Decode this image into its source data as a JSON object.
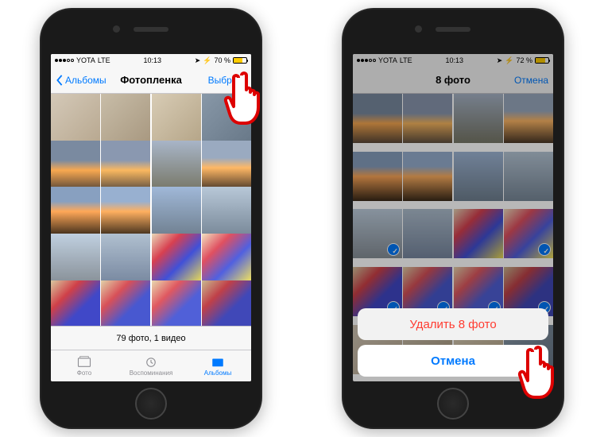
{
  "left": {
    "status": {
      "carrier": "YOTA",
      "network": "LTE",
      "time": "10:13",
      "battery": "70 %"
    },
    "nav": {
      "back": "Альбомы",
      "title": "Фотопленка",
      "action": "Выбрать"
    },
    "footer": "79 фото, 1 видео",
    "tabs": [
      {
        "label": "Фото",
        "active": false
      },
      {
        "label": "Воспоминания",
        "active": false
      },
      {
        "label": "Альбомы",
        "active": true
      }
    ]
  },
  "right": {
    "status": {
      "carrier": "YOTA",
      "network": "LTE",
      "time": "10:13",
      "battery": "72 %"
    },
    "nav": {
      "title": "8 фото",
      "action": "Отмена"
    },
    "sheet": {
      "delete": "Удалить 8 фото",
      "cancel": "Отмена"
    },
    "selected_indices": [
      8,
      11,
      12,
      13,
      14,
      15,
      16,
      17
    ]
  },
  "thumb_colors": [
    "linear-gradient(135deg,#d4c9b8,#b8a890)",
    "linear-gradient(135deg,#c8bda8,#a89880)",
    "linear-gradient(135deg,#d8ccb5,#b5a588)",
    "linear-gradient(135deg,#8898a8,#687888)",
    "linear-gradient(180deg,#7a8aa0 40%,#f8a850 60%,#5a4838)",
    "linear-gradient(180deg,#8a98b0 40%,#fab860 60%,#605040)",
    "linear-gradient(180deg,#a8b5c8,#787868)",
    "linear-gradient(180deg,#9aaac0 35%,#ffb865 55%,#4a3828)",
    "linear-gradient(180deg,#88a0c0 30%,#ffa858 50%,#382818)",
    "linear-gradient(180deg,#98b0d0 30%,#ffb060 50%,#3a2a1a)",
    "linear-gradient(180deg,#a0b8d8,#708090)",
    "linear-gradient(180deg,#b8c8d8,#788898)",
    "linear-gradient(180deg,#c0d0e0,#889098)",
    "linear-gradient(180deg,#b0c0d0,#7888a0)",
    "linear-gradient(135deg,#e8d8b8,#d84050 30%,#4050d8 60%,#f0e050)",
    "linear-gradient(135deg,#f0e0c0,#e05060 30%,#5060e0 60%,#f8e858)",
    "linear-gradient(135deg,#d8c8a0,#d04048 30%,#4048c8 60%)",
    "linear-gradient(135deg,#e0d0a8,#d85058 30%,#4858d0 60%)",
    "linear-gradient(135deg,#e8d8b0,#e05860 30%,#5060d8 60%)",
    "linear-gradient(135deg,#c8b890,#c04048 30%,#4048b8 60%)"
  ]
}
